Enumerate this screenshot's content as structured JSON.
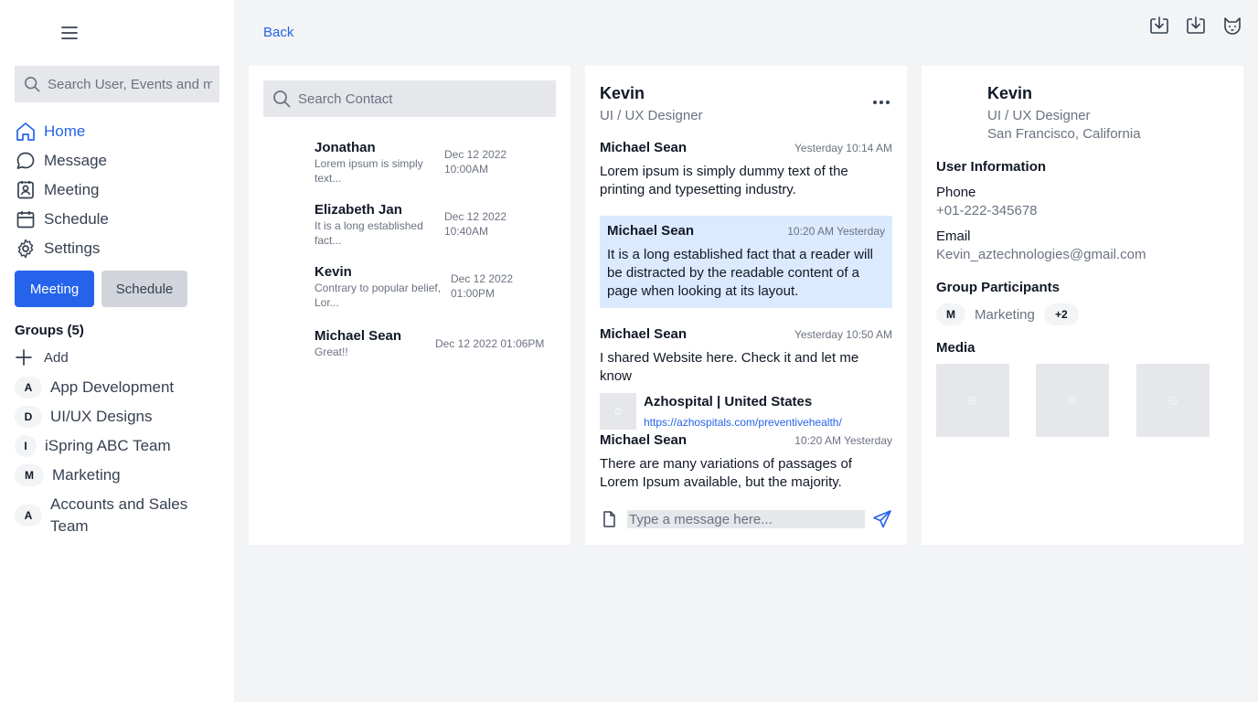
{
  "sidebar": {
    "search_placeholder": "Search User, Events and messages",
    "nav": [
      {
        "label": "Home",
        "icon": "home-icon",
        "active": true
      },
      {
        "label": "Message",
        "icon": "message-icon"
      },
      {
        "label": "Meeting",
        "icon": "meeting-icon"
      },
      {
        "label": "Schedule",
        "icon": "calendar-icon"
      },
      {
        "label": "Settings",
        "icon": "gear-icon"
      }
    ],
    "meeting_button": "Meeting",
    "schedule_button": "Schedule",
    "groups_title": "Groups (5)",
    "add_label": "Add",
    "groups": [
      {
        "initial": "A",
        "name": "App Development"
      },
      {
        "initial": "D",
        "name": "UI/UX Designs"
      },
      {
        "initial": "I",
        "name": "iSpring ABC Team"
      },
      {
        "initial": "M",
        "name": "Marketing"
      },
      {
        "initial": "A",
        "name": "Accounts and Sales Team"
      }
    ]
  },
  "header": {
    "back_label": "Back",
    "icons": [
      "download-icon",
      "download-icon",
      "cat-icon"
    ]
  },
  "contacts": {
    "search_placeholder": "Search Contact",
    "items": [
      {
        "name": "Jonathan",
        "preview": "Lorem ipsum is simply text...",
        "time": "Dec 12 2022 10:00AM"
      },
      {
        "name": "Elizabeth Jan",
        "preview": "It is a long established fact...",
        "time": "Dec 12 2022 10:40AM"
      },
      {
        "name": "Kevin",
        "preview": "Contrary to popular belief, Lor...",
        "time": "Dec 12 2022 01:00PM"
      },
      {
        "name": "Michael Sean",
        "preview": "Great!!",
        "time": "Dec 12 2022 01:06PM"
      }
    ]
  },
  "chat": {
    "name": "Kevin",
    "role": "UI / UX Designer",
    "messages": [
      {
        "sender": "Michael Sean",
        "time": "Yesterday 10:14 AM",
        "text": "Lorem ipsum is simply dummy text of the printing and typesetting industry."
      },
      {
        "sender": "Michael Sean",
        "time": "10:20 AM Yesterday",
        "text": "It is a long established fact that a reader will be distracted by the readable content of a page when looking at its layout."
      },
      {
        "sender": "Michael Sean",
        "time": "Yesterday 10:50 AM",
        "text": "I shared Website here. Check it and let me know",
        "link_title": "Azhospital | United States",
        "link_url": "https://azhospitals.com/preventivehealth/"
      },
      {
        "sender": "Michael Sean",
        "time": "10:20 AM Yesterday",
        "text": "There are many variations of passages of Lorem Ipsum available, but the majority."
      }
    ],
    "composer_placeholder": "Type a message here..."
  },
  "profile": {
    "name": "Kevin",
    "role": "UI / UX Designer",
    "location": "San Francisco, California",
    "info_title": "User Information",
    "phone_label": "Phone",
    "phone": "+01-222-345678",
    "email_label": "Email",
    "email": "Kevin_aztechnologies@gmail.com",
    "participants_title": "Group Participants",
    "participant_initial": "M",
    "participant_name": "Marketing",
    "participant_more": "+2",
    "media_title": "Media"
  },
  "colors": {
    "accent": "#2563eb",
    "highlight": "#dbeafe",
    "background": "#f3f4f6"
  }
}
